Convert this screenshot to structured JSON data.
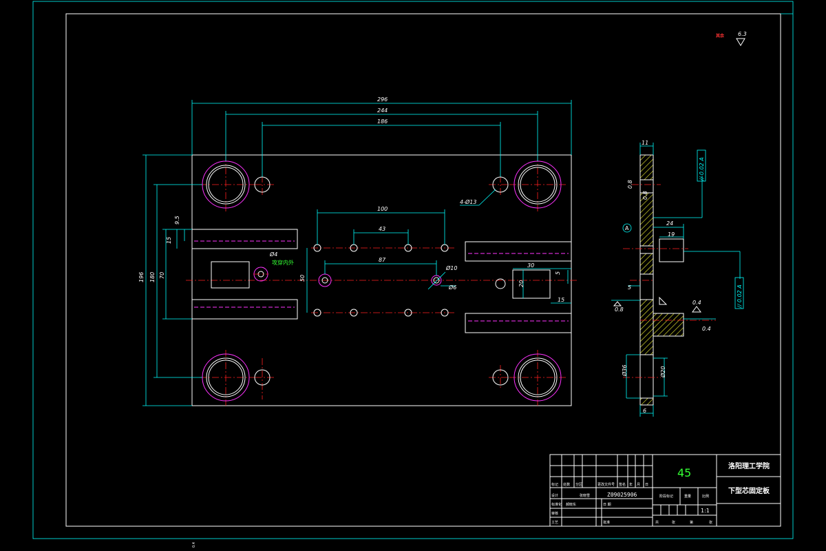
{
  "dimensions": {
    "overall_width": "296",
    "hole_span": "244",
    "small_hole_span": "186",
    "slot_span_100": "100",
    "spacing_43": "43",
    "spacing_87": "87",
    "slot_len_30": "30",
    "slot_w_20": "20",
    "slot_off_5": "5",
    "slot_off_15": "15",
    "height_196": "196",
    "height_180": "180",
    "height_70": "70",
    "height_50": "50",
    "tol_9_5": "9.5",
    "tol_15": "15",
    "hole_4_13": "4-Ø13",
    "dia_10": "Ø10",
    "dia_6": "Ø6",
    "dia_4": "Ø4",
    "green_note": "攻穿内外",
    "side_11": "11",
    "side_24": "24",
    "side_19": "19",
    "side_5": "5",
    "side_6": "6",
    "side_d36": "Ø36",
    "side_d20": "Ø20",
    "side_0_8a": "0.8",
    "side_0_8b": "0.8",
    "side_0_8c": "0.8",
    "side_0_4a": "0.4",
    "side_0_4b": "0.4",
    "datum_A": "A",
    "gdt1": "// 0.02 A",
    "gdt2": "// 0.02 A",
    "rough_top": "6.3",
    "rough_label": "其余",
    "stray": "0.4"
  },
  "title_block": {
    "material": "45",
    "school": "洛阳理工学院",
    "part_name": "下型芯固定板",
    "drawing_no": "Z09025906",
    "stage_mark": "阶段标记",
    "weight": "重量",
    "scale_label": "比例",
    "scale": "1:1",
    "total": "共",
    "sheets": "张",
    "page": "第",
    "sheet": "张",
    "mark": "标记",
    "count": "处数",
    "zone": "分区",
    "change_no": "更改文件号",
    "sign": "签名",
    "year": "年",
    "month": "月",
    "day": "日",
    "designer": "设计",
    "standardize": "标准化",
    "reviewer": "审核",
    "process": "工艺",
    "approve": "批准",
    "designer_name": "张晓雪",
    "std_name": "郝晓东",
    "date_approve": "日 期"
  }
}
